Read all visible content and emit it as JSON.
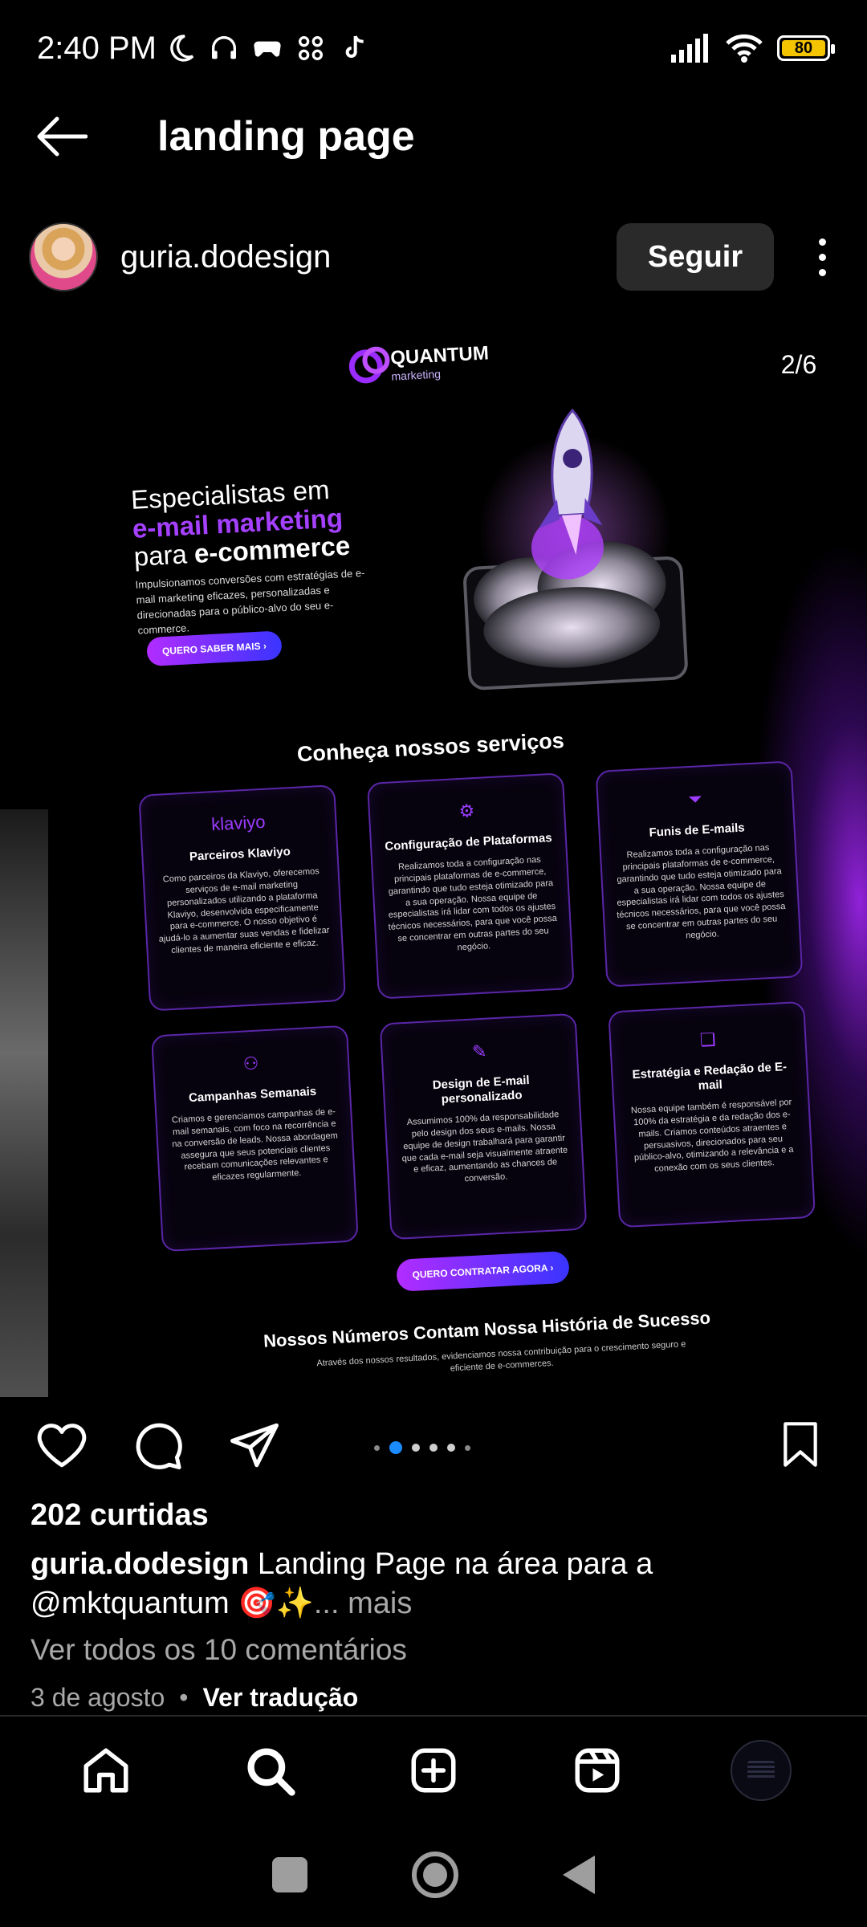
{
  "status_bar": {
    "time": "2:40 PM",
    "battery_level": "80",
    "battery_color": "#f5c400",
    "icons_left": [
      "moon-icon",
      "headphones-icon",
      "gamepad-icon",
      "app-grid-icon",
      "tiktok-icon"
    ],
    "icons_right": [
      "signal-icon",
      "wifi-icon",
      "battery-icon"
    ]
  },
  "header": {
    "title": "landing page",
    "back_icon": "arrow-left-icon"
  },
  "post": {
    "username": "guria.dodesign",
    "follow_label": "Seguir",
    "counter": "2/6",
    "media": {
      "logo_title": "QUANTUM",
      "logo_subtitle": "marketing",
      "hero_line1": "Especialistas em",
      "hero_line2": "e-mail marketing",
      "hero_line3_a": "para ",
      "hero_line3_b": "e-commerce",
      "hero_desc": "Impulsionamos conversões com estratégias de e-mail marketing eficazes, personalizadas e direcionadas para o público-alvo do seu e-commerce.",
      "hero_button": "QUERO SABER MAIS ›",
      "services_title": "Conheça nossos serviços",
      "cards": [
        {
          "icon": "klaviyo",
          "title": "Parceiros Klaviyo",
          "desc": "Como parceiros da Klaviyo, oferecemos serviços de e-mail marketing personalizados utilizando a plataforma Klaviyo, desenvolvida especificamente para e-commerce. O nosso objetivo é ajudá-lo a aumentar suas vendas e fidelizar clientes de maneira eficiente e eficaz."
        },
        {
          "icon": "⚙",
          "title": "Configuração de Plataformas",
          "desc": "Realizamos toda a configuração nas principais plataformas de e-commerce, garantindo que tudo esteja otimizado para a sua operação. Nossa equipe de especialistas irá lidar com todos os ajustes técnicos necessários, para que você possa se concentrar em outras partes do seu negócio."
        },
        {
          "icon": "⏷",
          "title": "Funis de E-mails",
          "desc": "Realizamos toda a configuração nas principais plataformas de e-commerce, garantindo que tudo esteja otimizado para a sua operação. Nossa equipe de especialistas irá lidar com todos os ajustes técnicos necessários, para que você possa se concentrar em outras partes do seu negócio."
        },
        {
          "icon": "⚇",
          "title": "Campanhas Semanais",
          "desc": "Criamos e gerenciamos campanhas de e-mail semanais, com foco na recorrência e na conversão de leads. Nossa abordagem assegura que seus potenciais clientes recebam comunicações relevantes e eficazes regularmente."
        },
        {
          "icon": "✎",
          "title": "Design de E-mail personalizado",
          "desc": "Assumimos 100% da responsabilidade pelo design dos seus e-mails. Nossa equipe de design trabalhará para garantir que cada e-mail seja visualmente atraente e eficaz, aumentando as chances de conversão."
        },
        {
          "icon": "❏",
          "title": "Estratégia e Redação de E-mail",
          "desc": "Nossa equipe também é responsável por 100% da estratégia e da redação dos e-mails. Criamos conteúdos atraentes e persuasivos, direcionados para seu público-alvo, otimizando a relevância e a conexão com os seus clientes."
        }
      ],
      "cta_button": "QUERO CONTRATAR AGORA ›",
      "numbers_title": "Nossos Números Contam Nossa História de Sucesso",
      "numbers_desc": "Através dos nossos resultados, evidenciamos nossa contribuição para o crescimento seguro e eficiente de e-commerces."
    },
    "carousel": {
      "total": 6,
      "active_index": 1,
      "active_color": "#1a8cff"
    },
    "likes": "202 curtidas",
    "caption_user": "guria.dodesign",
    "caption_text": " Landing Page na área para a @mktquantum 🎯✨",
    "caption_more": "... mais",
    "comments_link": "Ver todos os 10 comentários",
    "date": "3 de agosto",
    "separator": "•",
    "translate_label": "Ver tradução"
  },
  "bottom_nav": {
    "items": [
      "home-icon",
      "search-icon",
      "create-icon",
      "reels-icon",
      "profile-avatar"
    ]
  },
  "colors": {
    "accent_purple": "#9b2cff",
    "gradient_blue": "#3a34ff",
    "background": "#000000"
  }
}
